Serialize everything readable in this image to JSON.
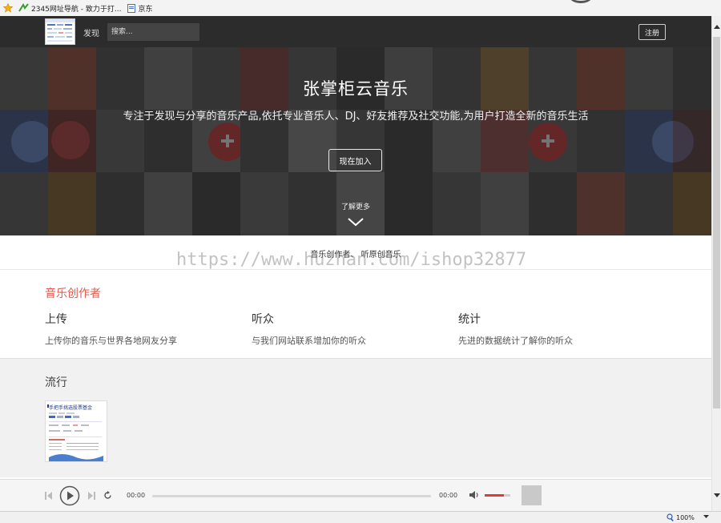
{
  "browser": {
    "favorites": [
      {
        "label": "2345网址导航 - 致力于打..."
      },
      {
        "label": "京东"
      }
    ],
    "zoom": "100%"
  },
  "navbar": {
    "discover_label": "发现",
    "search_placeholder": "搜索...",
    "register_label": "注册"
  },
  "hero": {
    "title": "张掌柜云音乐",
    "subtitle": "专注于发现与分享的音乐产品,依托专业音乐人、DJ、好友推荐及社交功能,为用户打造全新的音乐生活",
    "join_label": "现在加入",
    "learn_more_label": "了解更多"
  },
  "tagline": "音乐创作者、 听原创音乐",
  "watermark": "https://www.huzhan.com/ishop32877",
  "features": {
    "heading": "音乐创作者",
    "items": [
      {
        "title": "上传",
        "desc": "上传你的音乐与世界各地网友分享"
      },
      {
        "title": "听众",
        "desc": "与我们网站联系增加你的听众"
      },
      {
        "title": "统计",
        "desc": "先进的数据统计了解你的听众"
      }
    ]
  },
  "popular": {
    "heading": "流行",
    "thumb_title": "手把手挑选股票基金"
  },
  "player": {
    "current_time": "00:00",
    "total_time": "00:00",
    "progress": 0,
    "volume": 0.75
  },
  "colors": {
    "accent_red": "#e05a4f",
    "navbar_bg": "#2c2c2c",
    "volume_red": "#e03a3a"
  }
}
